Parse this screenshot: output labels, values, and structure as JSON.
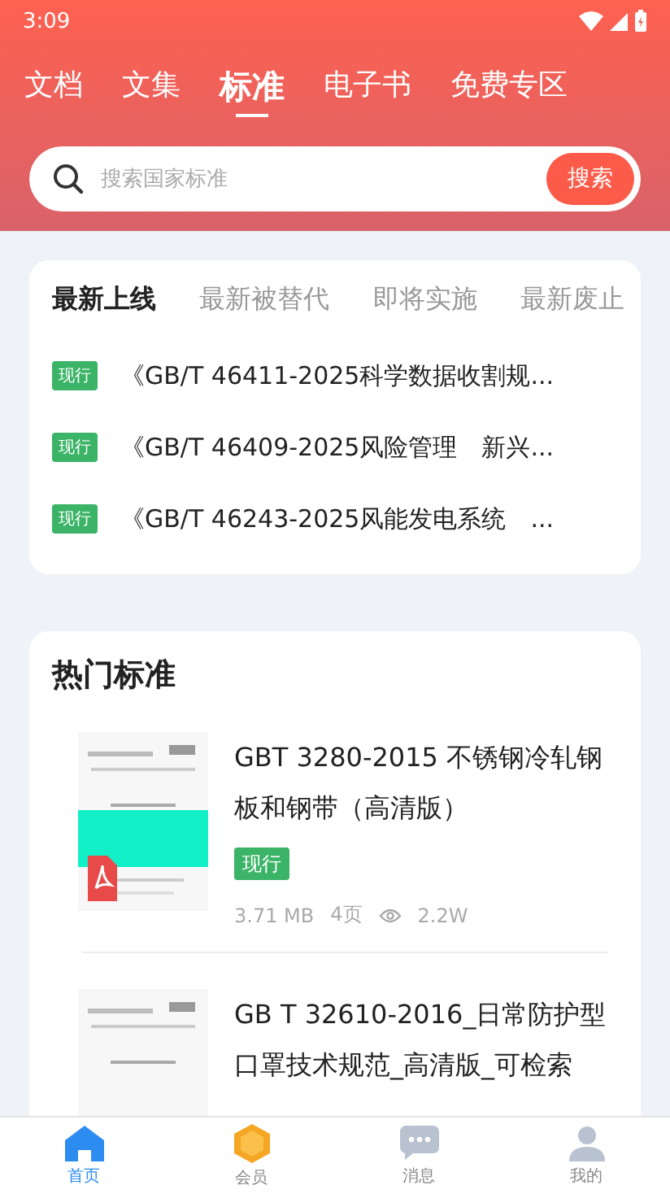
{
  "status_bar": {
    "time": "3:09"
  },
  "tabs": [
    {
      "label": "文档",
      "selected": false
    },
    {
      "label": "文集",
      "selected": false
    },
    {
      "label": "标准",
      "selected": true
    },
    {
      "label": "电子书",
      "selected": false
    },
    {
      "label": "免费专区",
      "selected": false
    }
  ],
  "search": {
    "placeholder": "搜索国家标准",
    "button": "搜索"
  },
  "latest": {
    "tabs": [
      {
        "label": "最新上线",
        "selected": true
      },
      {
        "label": "最新被替代",
        "selected": false
      },
      {
        "label": "即将实施",
        "selected": false
      },
      {
        "label": "最新废止",
        "selected": false
      }
    ],
    "items": [
      {
        "badge": "现行",
        "title": "《GB/T 46411-2025科学数据收割规..."
      },
      {
        "badge": "现行",
        "title": "《GB/T 46409-2025风险管理　新兴..."
      },
      {
        "badge": "现行",
        "title": "《GB/T 46243-2025风能发电系统　..."
      }
    ]
  },
  "hot": {
    "title": "热门标准",
    "docs": [
      {
        "title": "GBT 3280-2015 不锈钢冷轧钢板和钢带（高清版）",
        "badge": "现行",
        "size": "3.71 MB",
        "pages": "4页",
        "views": "2.2W"
      },
      {
        "title": "GB T 32610-2016_日常防护型口罩技术规范_高清版_可检索"
      }
    ]
  },
  "nav": [
    {
      "kind": "home",
      "label": "首页",
      "selected": true
    },
    {
      "kind": "vip",
      "label": "会员",
      "selected": false
    },
    {
      "kind": "message",
      "label": "消息",
      "selected": false
    },
    {
      "kind": "profile",
      "label": "我的",
      "selected": false
    }
  ]
}
